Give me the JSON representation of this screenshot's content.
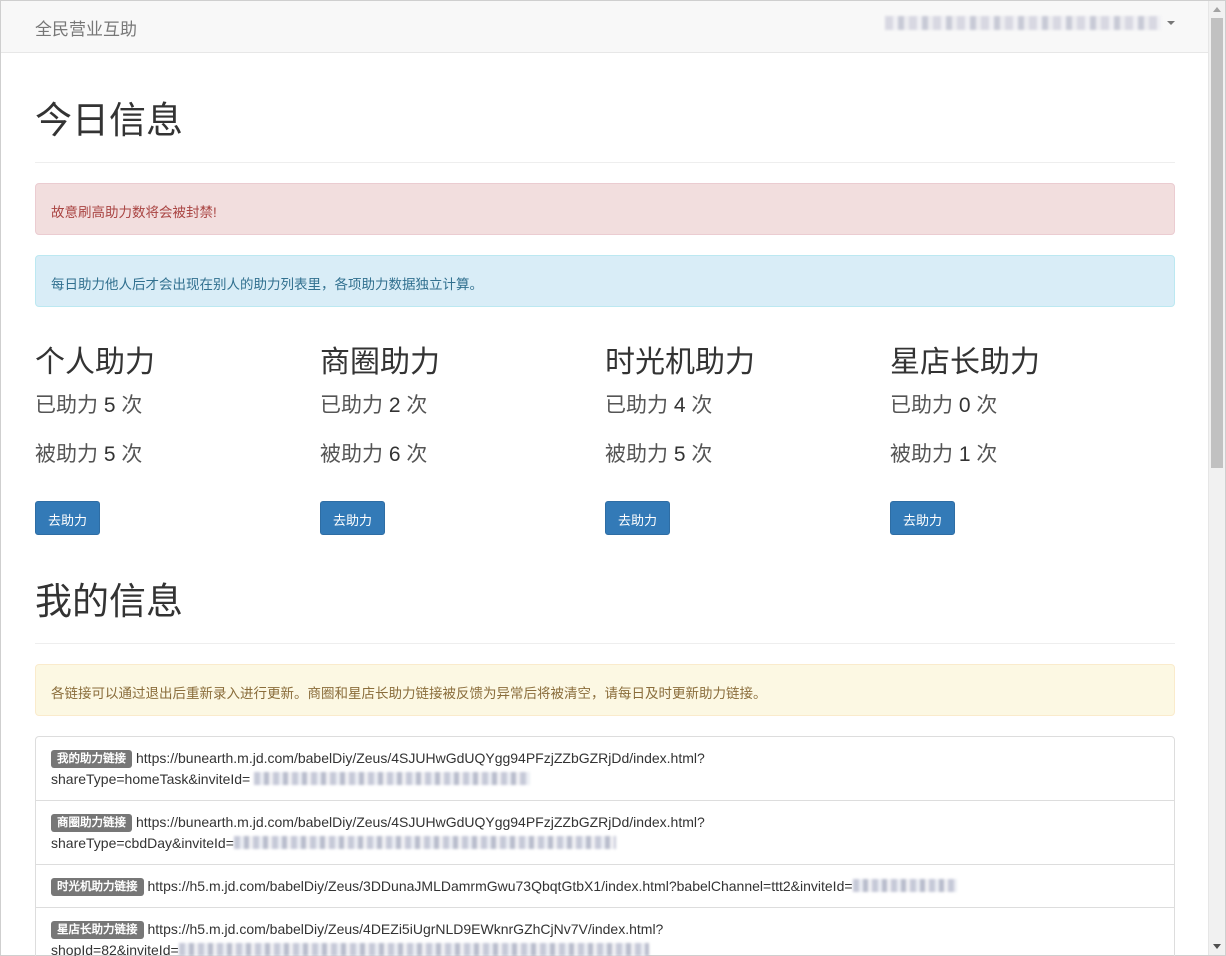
{
  "navbar": {
    "brand": "全民营业互助"
  },
  "today": {
    "title": "今日信息",
    "alert_danger": "故意刷高助力数将会被封禁!",
    "alert_info": "每日助力他人后才会出现在别人的助力列表里，各项助力数据独立计算。",
    "stats": [
      {
        "title": "个人助力",
        "helped_prefix": "已助力",
        "helped": "5",
        "helped_suffix": "次",
        "received_prefix": "被助力",
        "received": "5",
        "received_suffix": "次",
        "button": "去助力"
      },
      {
        "title": "商圈助力",
        "helped_prefix": "已助力",
        "helped": "2",
        "helped_suffix": "次",
        "received_prefix": "被助力",
        "received": "6",
        "received_suffix": "次",
        "button": "去助力"
      },
      {
        "title": "时光机助力",
        "helped_prefix": "已助力",
        "helped": "4",
        "helped_suffix": "次",
        "received_prefix": "被助力",
        "received": "5",
        "received_suffix": "次",
        "button": "去助力"
      },
      {
        "title": "星店长助力",
        "helped_prefix": "已助力",
        "helped": "0",
        "helped_suffix": "次",
        "received_prefix": "被助力",
        "received": "1",
        "received_suffix": "次",
        "button": "去助力"
      }
    ]
  },
  "mine": {
    "title": "我的信息",
    "alert_warning": "各链接可以通过退出后重新录入进行更新。商圈和星店长助力链接被反馈为异常后将被清空，请每日及时更新助力链接。",
    "links": [
      {
        "label": "我的助力链接",
        "url_line1": "https://bunearth.m.jd.com/babelDiy/Zeus/4SJUHwGdUQYgg94PFzjZZbGZRjDd/index.html?",
        "url_line2": "shareType=homeTask&inviteId="
      },
      {
        "label": "商圈助力链接",
        "url_line1": "https://bunearth.m.jd.com/babelDiy/Zeus/4SJUHwGdUQYgg94PFzjZZbGZRjDd/index.html?",
        "url_line2": "shareType=cbdDay&inviteId="
      },
      {
        "label": "时光机助力链接",
        "url_line1": "https://h5.m.jd.com/babelDiy/Zeus/3DDunaJMLDamrmGwu73QbqtGtbX1/index.html?babelChannel=ttt2&inviteId=",
        "url_line2": ""
      },
      {
        "label": "星店长助力链接",
        "url_line1": "https://h5.m.jd.com/babelDiy/Zeus/4DEZi5iUgrNLD9EWknrGZhCjNv7V/index.html?",
        "url_line2": "shopId=82&inviteId="
      }
    ]
  }
}
